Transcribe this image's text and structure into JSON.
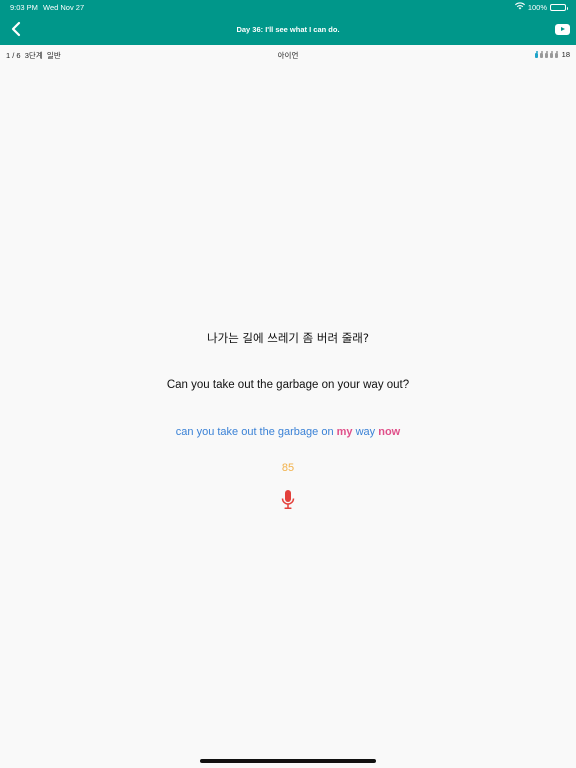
{
  "status_bar": {
    "time": "9:03 PM",
    "date": "Wed Nov 27",
    "battery": "100%"
  },
  "nav": {
    "title": "Day 36: I'll see what I can do.",
    "back_icon": "chevron-left-icon",
    "video_icon": "youtube-play-icon"
  },
  "info": {
    "progress": "1 / 6",
    "level": "3단계",
    "mode": "일반",
    "center": "아이언",
    "people_icons": [
      "active",
      "dim",
      "dim",
      "dim",
      "dim"
    ],
    "people_count": "18"
  },
  "sentence": {
    "korean": "나가는 길에 쓰레기 좀 버려 줄래?",
    "english": "Can you take out the garbage on your way out?"
  },
  "recognized": {
    "parts": [
      {
        "text": "can you take out the garbage on ",
        "correct": true
      },
      {
        "text": "my",
        "correct": false
      },
      {
        "text": " way ",
        "correct": true
      },
      {
        "text": "now",
        "correct": false
      }
    ]
  },
  "score": "85",
  "colors": {
    "header": "#00978a",
    "recognized_correct": "#3b82d6",
    "recognized_wrong": "#e0508a",
    "score": "#f2b14a",
    "mic": "#e3403b"
  }
}
